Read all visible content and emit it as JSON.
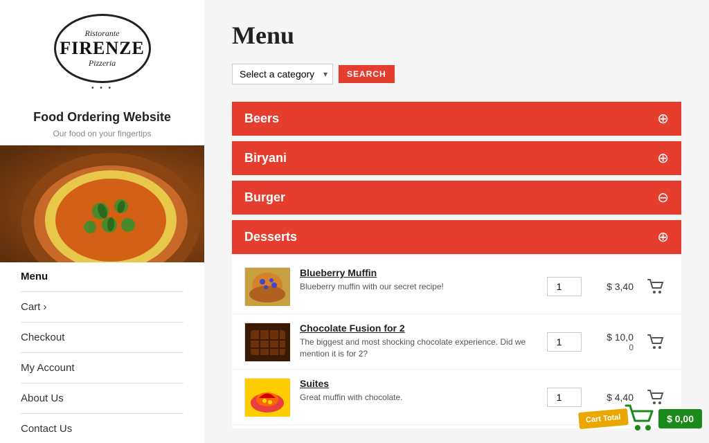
{
  "sidebar": {
    "logo": {
      "top": "Ristorante",
      "main": "FIRENZE",
      "bottom": "Pizzeria",
      "dots": "• • •"
    },
    "site_title": "Food Ordering Website",
    "site_subtitle": "Our food on your fingertips",
    "nav": [
      {
        "label": "Menu",
        "active": true
      },
      {
        "label": "Cart ›",
        "active": false
      },
      {
        "label": "Checkout",
        "active": false
      },
      {
        "label": "My Account",
        "active": false
      },
      {
        "label": "About Us",
        "active": false
      },
      {
        "label": "Contact Us",
        "active": false
      }
    ]
  },
  "main": {
    "title": "Menu",
    "filter": {
      "placeholder": "Select a category",
      "search_label": "SEARCH"
    },
    "categories": [
      {
        "name": "Beers",
        "expanded": false,
        "icon_type": "plus"
      },
      {
        "name": "Biryani",
        "expanded": false,
        "icon_type": "plus"
      },
      {
        "name": "Burger",
        "expanded": false,
        "icon_type": "minus"
      },
      {
        "name": "Desserts",
        "expanded": true,
        "icon_type": "plus",
        "items": [
          {
            "name": "Blueberry Muffin",
            "description": "Blueberry muffin with our secret recipe!",
            "price": "$ 3,40",
            "price_sub": "",
            "qty": "1",
            "img_type": "muffin"
          },
          {
            "name": "Chocolate Fusion for 2",
            "description": "The biggest and most shocking chocolate experience. Did we mention it is for 2?",
            "price": "$ 10,0",
            "price_sub": "0",
            "qty": "1",
            "img_type": "chocolate"
          },
          {
            "name": "Suites",
            "description": "Great muffin with chocolate.",
            "price": "$ 4,40",
            "price_sub": "",
            "qty": "1",
            "img_type": "suites"
          }
        ]
      }
    ]
  },
  "cart": {
    "label": "Cart Total",
    "amount": "$ 0,00"
  }
}
